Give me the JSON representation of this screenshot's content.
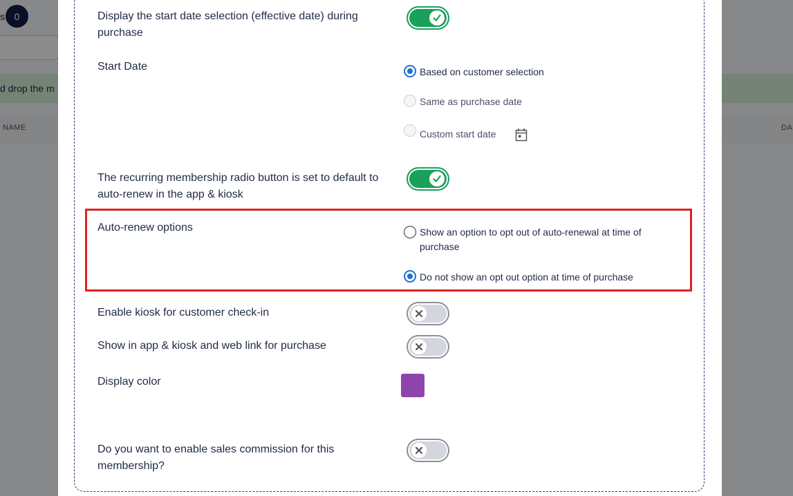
{
  "background": {
    "badge_count": "0",
    "partial_label": "s",
    "banner_text": "d drop the m",
    "col_left": "NAME",
    "col_right": "DA"
  },
  "settings": {
    "display_start_date": {
      "label": "Display the start date selection (effective date) during purchase",
      "enabled": true
    },
    "start_date": {
      "label": "Start Date",
      "options": [
        {
          "label": "Based on customer selection",
          "selected": true
        },
        {
          "label": "Same as purchase date",
          "selected": false
        },
        {
          "label": "Custom start date",
          "selected": false
        }
      ],
      "calendar_icon": "calendar-icon"
    },
    "recurring_default": {
      "label": "The recurring membership radio button is set to default to auto-renew in the app & kiosk",
      "enabled": true
    },
    "auto_renew": {
      "label": "Auto-renew options",
      "options": [
        {
          "label": "Show an option to opt out of auto-renewal at time of purchase",
          "selected": false
        },
        {
          "label": "Do not show an opt out option at time of purchase",
          "selected": true
        }
      ]
    },
    "kiosk_checkin": {
      "label": "Enable kiosk for customer check-in",
      "enabled": false
    },
    "show_in_app": {
      "label": "Show in app & kiosk and web link for purchase",
      "enabled": false
    },
    "display_color": {
      "label": "Display color",
      "color": "#8e44ad"
    },
    "sales_commission": {
      "label": "Do you want to enable sales commission for this membership?",
      "enabled": false
    }
  },
  "colors": {
    "toggle_on": "#19a05a",
    "radio_selected": "#1a73d1",
    "highlight": "#e02020"
  }
}
